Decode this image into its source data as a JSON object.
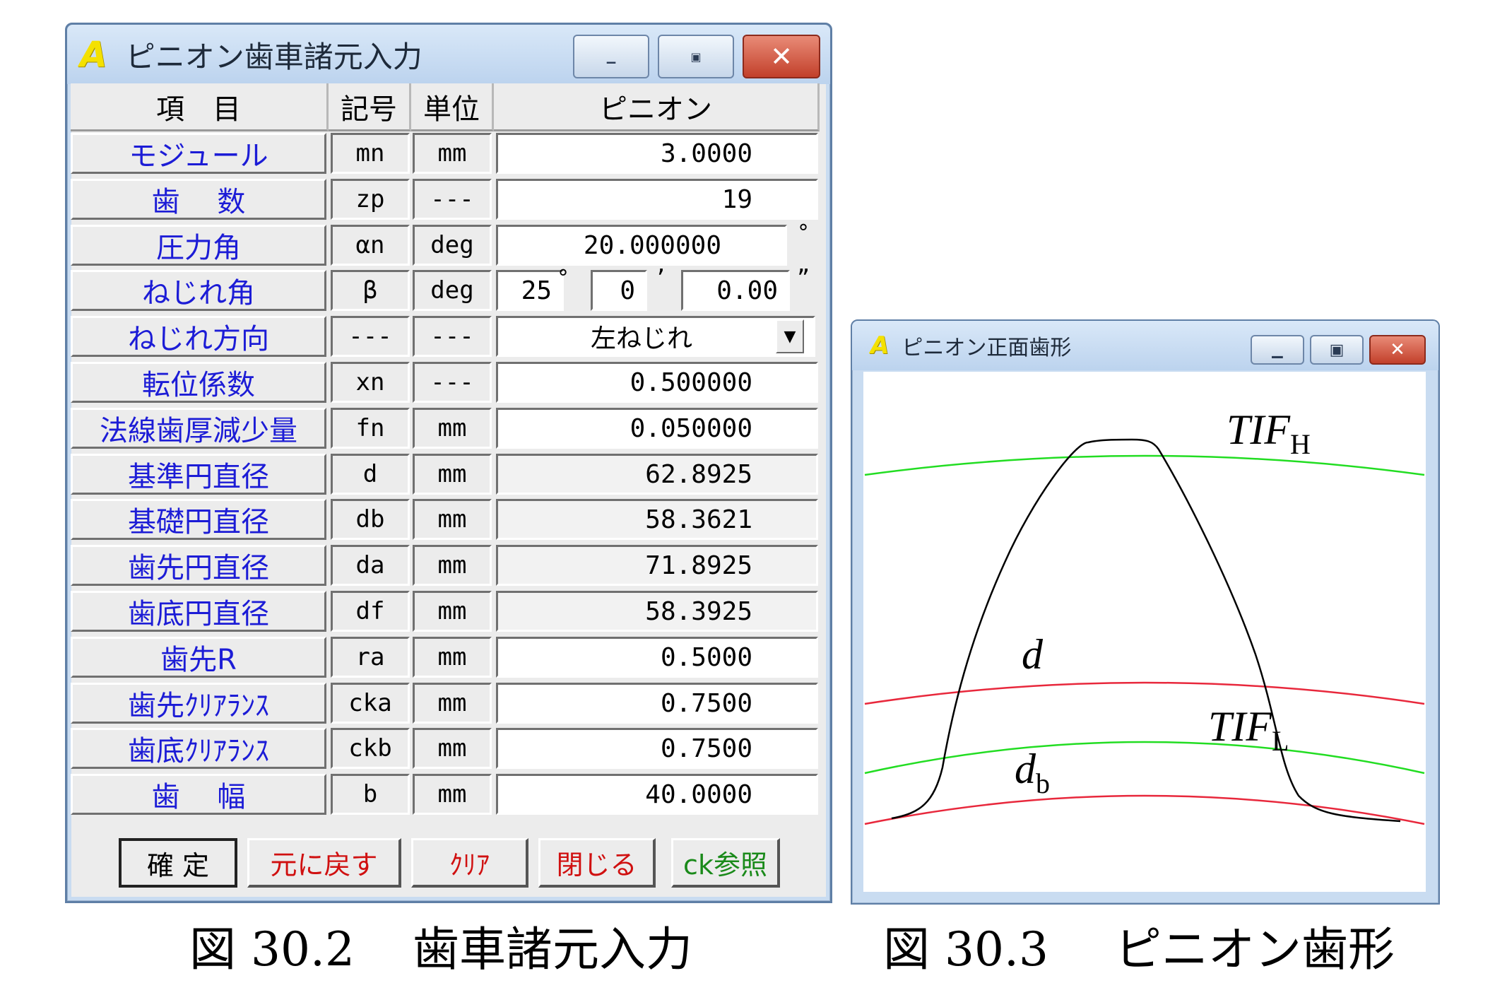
{
  "input_window": {
    "logo": "A",
    "title": "ピニオン歯車諸元入力",
    "controls": [
      "minimize-icon",
      "maximize-icon",
      "close-icon"
    ],
    "headers": {
      "item": "項　目",
      "symbol": "記号",
      "unit": "単位",
      "value": "ピニオン"
    },
    "rows": [
      {
        "label": "モジュール",
        "symbol": "mn",
        "unit": "mm",
        "value": "3.0000"
      },
      {
        "label": "歯　 数",
        "symbol": "zp",
        "unit": "---",
        "value": "19"
      },
      {
        "label": "圧力角",
        "symbol": "αn",
        "unit": "deg",
        "value": "20.000000",
        "suffix": "°"
      },
      {
        "label": "ねじれ角",
        "symbol": "β",
        "unit": "deg",
        "deg": "25",
        "min": "0",
        "sec": "0.00"
      },
      {
        "label": "ねじれ方向",
        "symbol": "---",
        "unit": "---",
        "dropdown": "左ねじれ"
      },
      {
        "label": "転位係数",
        "symbol": "xn",
        "unit": "---",
        "value": "0.500000"
      },
      {
        "label": "法線歯厚減少量",
        "symbol": "fn",
        "unit": "mm",
        "value": "0.050000"
      },
      {
        "label": "基準円直径",
        "symbol": "d",
        "unit": "mm",
        "value": "62.8925"
      },
      {
        "label": "基礎円直径",
        "symbol": "db",
        "unit": "mm",
        "value": "58.3621"
      },
      {
        "label": "歯先円直径",
        "symbol": "da",
        "unit": "mm",
        "value": "71.8925"
      },
      {
        "label": "歯底円直径",
        "symbol": "df",
        "unit": "mm",
        "value": "58.3925"
      },
      {
        "label": "歯先R",
        "symbol": "ra",
        "unit": "mm",
        "value": "0.5000"
      },
      {
        "label": "歯先ｸﾘｱﾗﾝｽ",
        "symbol": "cka",
        "unit": "mm",
        "value": "0.7500"
      },
      {
        "label": "歯底ｸﾘｱﾗﾝｽ",
        "symbol": "ckb",
        "unit": "mm",
        "value": "0.7500"
      },
      {
        "label": "歯　 幅",
        "symbol": "b",
        "unit": "mm",
        "value": "40.0000"
      }
    ],
    "buttons": [
      {
        "label": "確 定",
        "color": "#000000"
      },
      {
        "label": "元に戻す",
        "color": "#d01010"
      },
      {
        "label": "ｸﾘｱ",
        "color": "#d01010"
      },
      {
        "label": "閉じる",
        "color": "#d01010"
      },
      {
        "label": "ck参照",
        "color": "#1a8a1a"
      }
    ]
  },
  "plot_window": {
    "logo": "A",
    "title": "ピニオン正面歯形",
    "curves": {
      "tif_color": "#22dd22",
      "circle_color": "#e8283c",
      "profile_color": "#000000"
    },
    "labels": {
      "tif_h": "TIF",
      "tif_h_sub": "H",
      "d": "d",
      "tif_l": "TIF",
      "tif_l_sub": "L",
      "db": "d",
      "db_sub": "b"
    }
  },
  "captions": {
    "left_num": "図 30.2",
    "left_text": "歯車諸元入力",
    "right_num": "図 30.3",
    "right_text": "ピニオン歯形"
  }
}
